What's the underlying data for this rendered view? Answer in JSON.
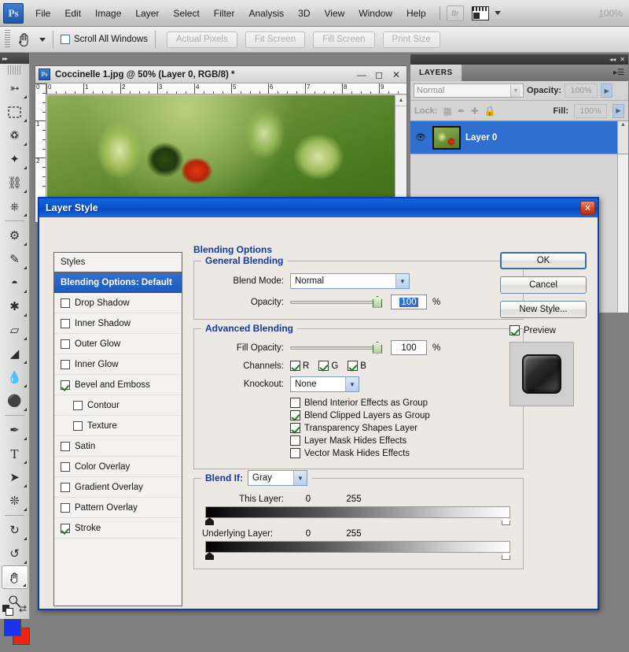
{
  "app": {
    "logo": "Ps",
    "zoom_level": "100%",
    "bridge_button": "Br",
    "menus": [
      "File",
      "Edit",
      "Image",
      "Layer",
      "Select",
      "Filter",
      "Analysis",
      "3D",
      "View",
      "Window",
      "Help"
    ]
  },
  "options_bar": {
    "tool_icon": "hand-tool",
    "scroll_all_windows_label": "Scroll All Windows",
    "scroll_all_windows_checked": false,
    "buttons": [
      "Actual Pixels",
      "Fit Screen",
      "Fill Screen",
      "Print Size"
    ]
  },
  "toolbox": {
    "tools": [
      {
        "name": "move-tool",
        "glyph": "↖"
      },
      {
        "name": "marquee-tool",
        "glyph": "▭"
      },
      {
        "name": "lasso-tool",
        "glyph": "☂"
      },
      {
        "name": "magic-wand-tool",
        "glyph": "✦"
      },
      {
        "name": "crop-tool",
        "glyph": "⌗"
      },
      {
        "name": "eyedropper-tool",
        "glyph": "✐"
      },
      {
        "name": "healing-brush-tool",
        "glyph": "⊕"
      },
      {
        "name": "brush-tool",
        "glyph": "✒"
      },
      {
        "name": "clone-stamp-tool",
        "glyph": "⚓"
      },
      {
        "name": "history-brush-tool",
        "glyph": "✎"
      },
      {
        "name": "eraser-tool",
        "glyph": "▱"
      },
      {
        "name": "paint-bucket-tool",
        "glyph": "◢"
      },
      {
        "name": "blur-tool",
        "glyph": "●"
      },
      {
        "name": "dodge-tool",
        "glyph": "⚫"
      },
      {
        "name": "pen-tool",
        "glyph": "✒"
      },
      {
        "name": "type-tool",
        "glyph": "T"
      },
      {
        "name": "path-selection-tool",
        "glyph": "➤"
      },
      {
        "name": "shape-tool",
        "glyph": "⬟"
      },
      {
        "name": "rotate-3d-tool",
        "glyph": "↻"
      },
      {
        "name": "orbit-3d-tool",
        "glyph": "↺"
      },
      {
        "name": "hand-tool",
        "glyph": "✋"
      },
      {
        "name": "zoom-tool",
        "glyph": "⚲"
      }
    ],
    "foreground_color": "#1b33ee",
    "background_color": "#ee2211"
  },
  "document": {
    "title": "Coccinelle 1.jpg @ 50% (Layer 0, RGB/8) *",
    "ruler_units": [
      "0",
      "1",
      "2",
      "3",
      "4",
      "5",
      "6",
      "7",
      "8",
      "9"
    ],
    "ruler_vertical": [
      "0",
      "1",
      "2"
    ],
    "window_buttons": [
      "minimize",
      "maximize",
      "close"
    ]
  },
  "layers_panel": {
    "tab_title": "LAYERS",
    "blend_mode": "Normal",
    "opacity_label": "Opacity:",
    "opacity_value": "100%",
    "lock_label": "Lock:",
    "lock_icons": [
      "transparency-lock",
      "image-lock",
      "position-lock",
      "all-lock"
    ],
    "fill_label": "Fill:",
    "fill_value": "100%",
    "layers": [
      {
        "name": "Layer 0",
        "visible": true,
        "selected": true
      }
    ]
  },
  "dialog": {
    "title": "Layer Style",
    "close_label": "×",
    "styles_header": "Styles",
    "styles": [
      {
        "label": "Blending Options: Default",
        "checkbox": false,
        "selected": true,
        "indented": false
      },
      {
        "label": "Drop Shadow",
        "checkbox": true,
        "checked": false,
        "indented": false
      },
      {
        "label": "Inner Shadow",
        "checkbox": true,
        "checked": false,
        "indented": false
      },
      {
        "label": "Outer Glow",
        "checkbox": true,
        "checked": false,
        "indented": false
      },
      {
        "label": "Inner Glow",
        "checkbox": true,
        "checked": false,
        "indented": false
      },
      {
        "label": "Bevel and Emboss",
        "checkbox": true,
        "checked": true,
        "indented": false
      },
      {
        "label": "Contour",
        "checkbox": true,
        "checked": false,
        "indented": true
      },
      {
        "label": "Texture",
        "checkbox": true,
        "checked": false,
        "indented": true
      },
      {
        "label": "Satin",
        "checkbox": true,
        "checked": false,
        "indented": false
      },
      {
        "label": "Color Overlay",
        "checkbox": true,
        "checked": false,
        "indented": false
      },
      {
        "label": "Gradient Overlay",
        "checkbox": true,
        "checked": false,
        "indented": false
      },
      {
        "label": "Pattern Overlay",
        "checkbox": true,
        "checked": false,
        "indented": false
      },
      {
        "label": "Stroke",
        "checkbox": true,
        "checked": true,
        "indented": false
      }
    ],
    "blending_options_legend": "Blending Options",
    "general_blending": {
      "legend": "General Blending",
      "blend_mode_label": "Blend Mode:",
      "blend_mode_value": "Normal",
      "opacity_label": "Opacity:",
      "opacity_value": "100",
      "opacity_unit": "%",
      "opacity_slider_pct": 100
    },
    "advanced_blending": {
      "legend": "Advanced Blending",
      "fill_opacity_label": "Fill Opacity:",
      "fill_opacity_value": "100",
      "fill_opacity_unit": "%",
      "fill_opacity_slider_pct": 100,
      "channels_label": "Channels:",
      "channels": [
        {
          "label": "R",
          "checked": true
        },
        {
          "label": "G",
          "checked": true
        },
        {
          "label": "B",
          "checked": true
        }
      ],
      "knockout_label": "Knockout:",
      "knockout_value": "None",
      "checkboxes": [
        {
          "label": "Blend Interior Effects as Group",
          "checked": false
        },
        {
          "label": "Blend Clipped Layers as Group",
          "checked": true
        },
        {
          "label": "Transparency Shapes Layer",
          "checked": true
        },
        {
          "label": "Layer Mask Hides Effects",
          "checked": false
        },
        {
          "label": "Vector Mask Hides Effects",
          "checked": false
        }
      ]
    },
    "blend_if": {
      "legend": "Blend If:",
      "channel_value": "Gray",
      "this_layer_label": "This Layer:",
      "this_layer_min": "0",
      "this_layer_max": "255",
      "underlying_layer_label": "Underlying Layer:",
      "underlying_layer_min": "0",
      "underlying_layer_max": "255"
    },
    "buttons": {
      "ok": "OK",
      "cancel": "Cancel",
      "new_style": "New Style...",
      "preview_label": "Preview",
      "preview_checked": true
    }
  },
  "colors": {
    "dialog_title_blue": "#0b52cd",
    "selection_blue": "#2f6fd0",
    "legend_blue": "#15389c",
    "check_green": "#1b7a1b"
  }
}
